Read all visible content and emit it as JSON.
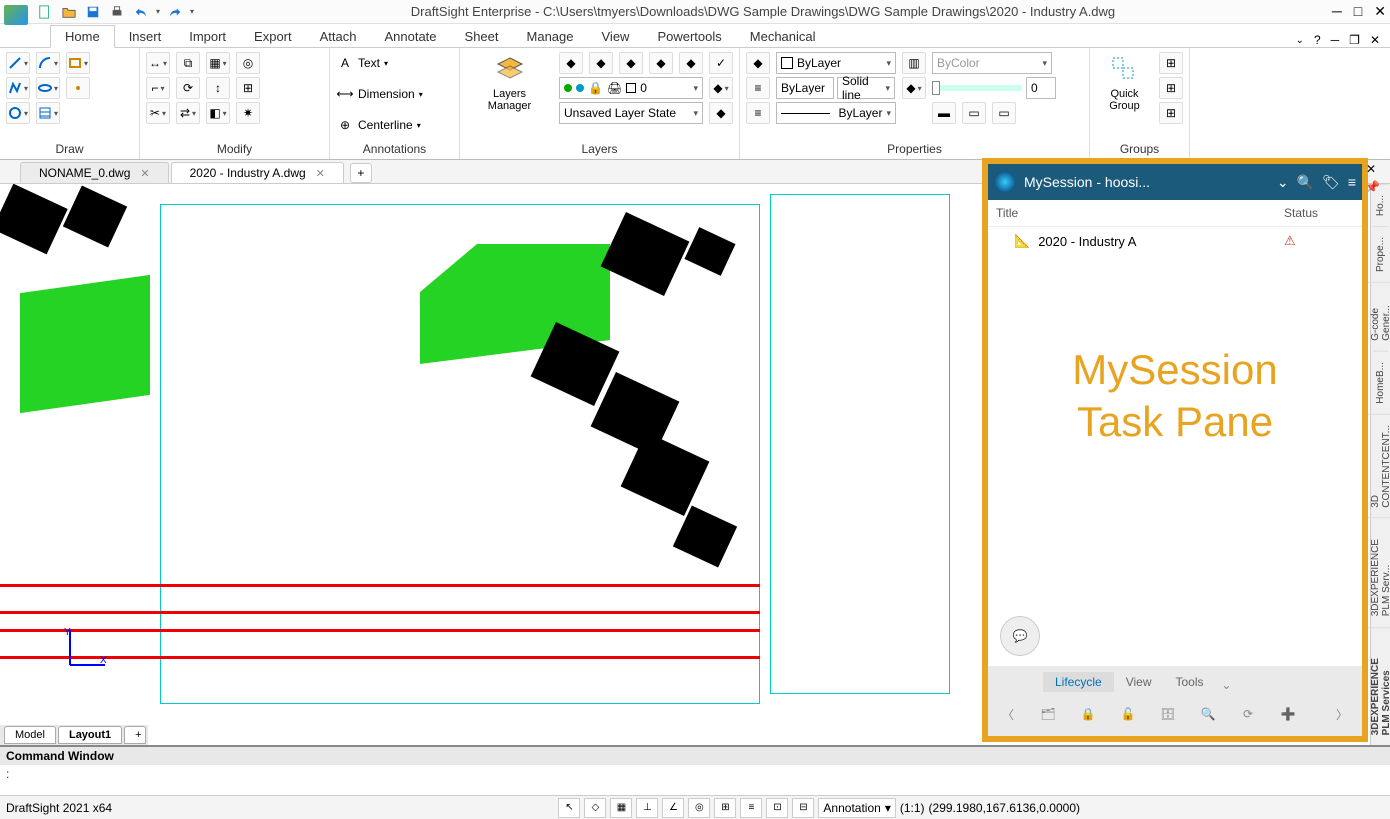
{
  "app": {
    "title": "DraftSight Enterprise - C:\\Users\\tmyers\\Downloads\\DWG Sample Drawings\\DWG Sample Drawings\\2020 - Industry A.dwg",
    "version": "DraftSight 2021 x64"
  },
  "ribbon": {
    "tabs": [
      "Home",
      "Insert",
      "Import",
      "Export",
      "Attach",
      "Annotate",
      "Sheet",
      "Manage",
      "View",
      "Powertools",
      "Mechanical"
    ],
    "active_tab": "Home",
    "panels": {
      "draw": "Draw",
      "modify": "Modify",
      "annotations": "Annotations",
      "layers": "Layers",
      "properties": "Properties",
      "groups": "Groups"
    },
    "annotations": {
      "text": "Text",
      "dimension": "Dimension",
      "centerline": "Centerline"
    },
    "layers": {
      "manager": "Layers Manager",
      "current_layer": "0",
      "layer_state": "Unsaved Layer State"
    },
    "properties": {
      "color": "ByLayer",
      "linetype": "ByLayer",
      "linestyle_desc": "Solid line",
      "lineweight": "ByLayer",
      "transparency_mode": "ByColor",
      "transparency_value": "0"
    },
    "groups": {
      "quick_group": "Quick Group"
    }
  },
  "doc_tabs": {
    "tab1": "NONAME_0.dwg",
    "tab2": "2020 - Industry A.dwg"
  },
  "model_tabs": {
    "model": "Model",
    "layout1": "Layout1"
  },
  "command_window": {
    "title": "Command Window",
    "prompt": ":"
  },
  "status": {
    "annotation_dd": "Annotation",
    "scale": "(1:1)",
    "coords": "(299.1980,167.6136,0.0000)"
  },
  "side_tabs": [
    "Ho...",
    "Prope...",
    "G-code Gener...",
    "HomeB...",
    "3D CONTENTCENT...",
    "3DEXPERIENCE PLM Serv...",
    "3DEXPERIENCE PLM Services"
  ],
  "mysession": {
    "title": "MySession - hoosi...",
    "col_title": "Title",
    "col_status": "Status",
    "item1": "2020 - Industry A",
    "overlay_line1": "MySession",
    "overlay_line2": "Task Pane",
    "tabs": {
      "lifecycle": "Lifecycle",
      "view": "View",
      "tools": "Tools"
    }
  }
}
